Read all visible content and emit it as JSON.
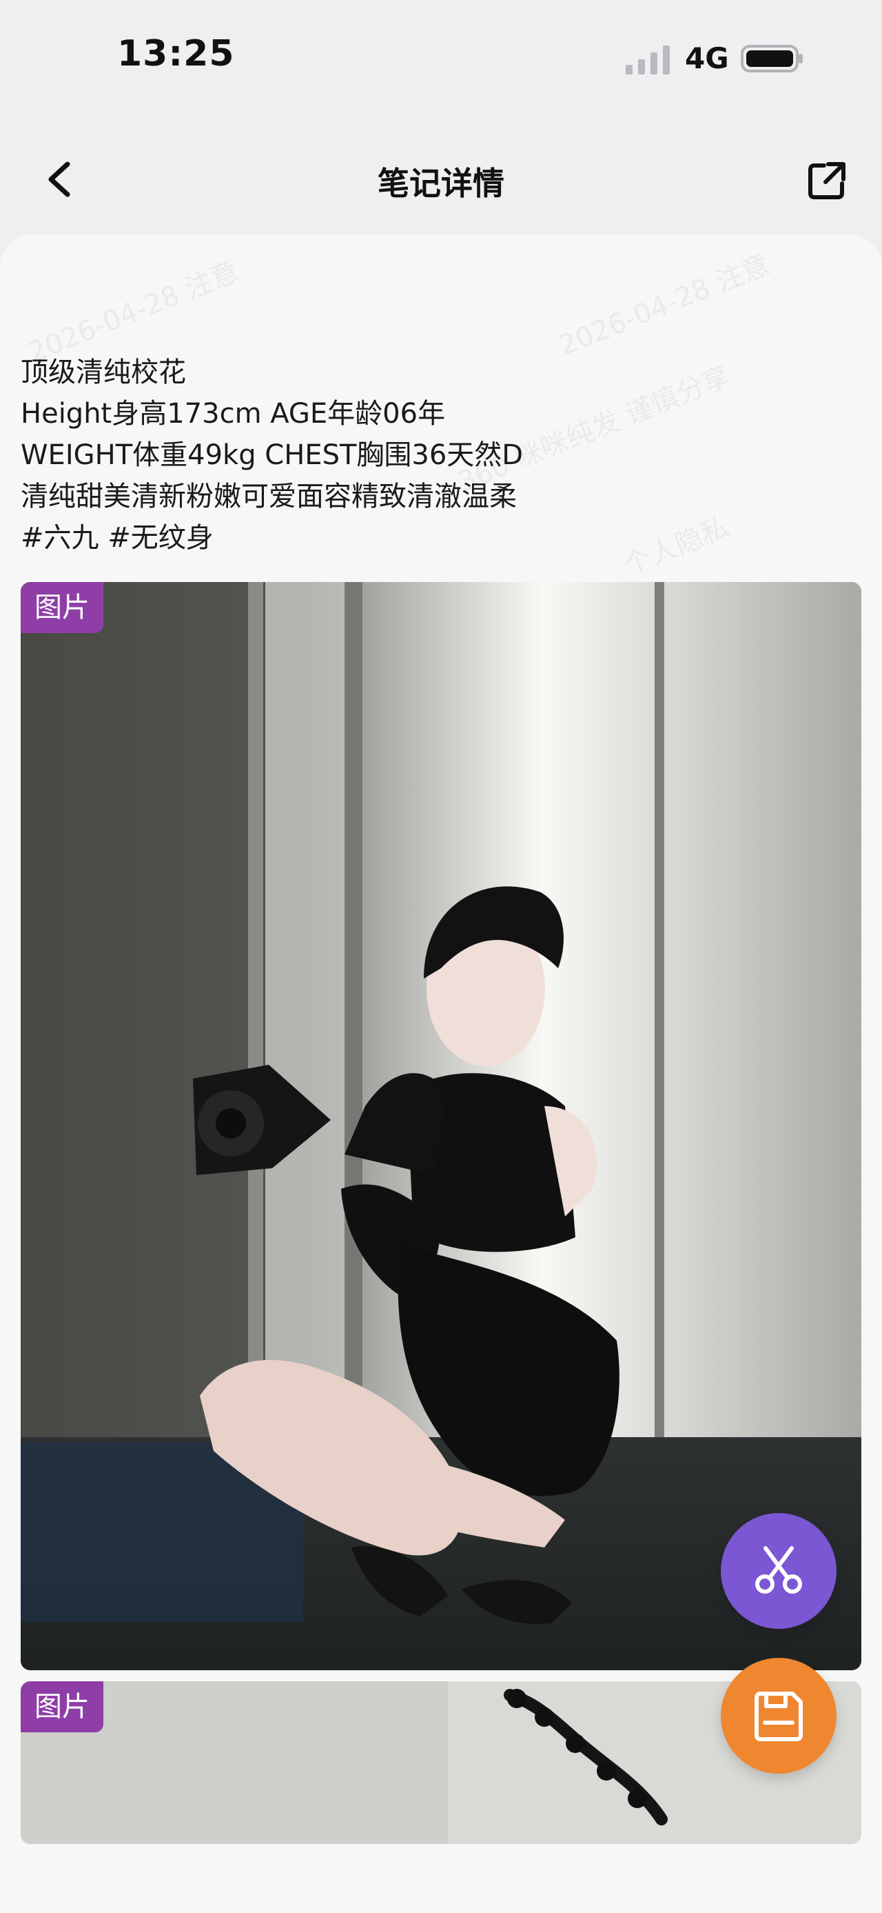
{
  "status_bar": {
    "time": "13:25",
    "network": "4G"
  },
  "header": {
    "title": "笔记详情"
  },
  "watermark": {
    "line1": "2026-04-28 注意",
    "line2": "2026-04-28 注意",
    "line3": "360 咪咪纯发  谨慎分享",
    "line4": "个人隐私"
  },
  "note": {
    "lines": [
      "顶级清纯校花",
      "Height身高173cm AGE年龄06年",
      "WEIGHT体重49kg CHEST胸围36天然D",
      "清纯甜美清新粉嫩可爱面容精致清澈温柔",
      "#六九 #无纹身"
    ]
  },
  "media": [
    {
      "badge": "图片"
    },
    {
      "badge": "图片"
    }
  ],
  "icons": {
    "back": "chevron-left-icon",
    "share": "share-icon",
    "cut": "scissors-icon",
    "save": "save-icon"
  },
  "colors": {
    "badge": "#8e3ea6",
    "cut_button": "#7b57d4",
    "save_button": "#ef8630"
  }
}
